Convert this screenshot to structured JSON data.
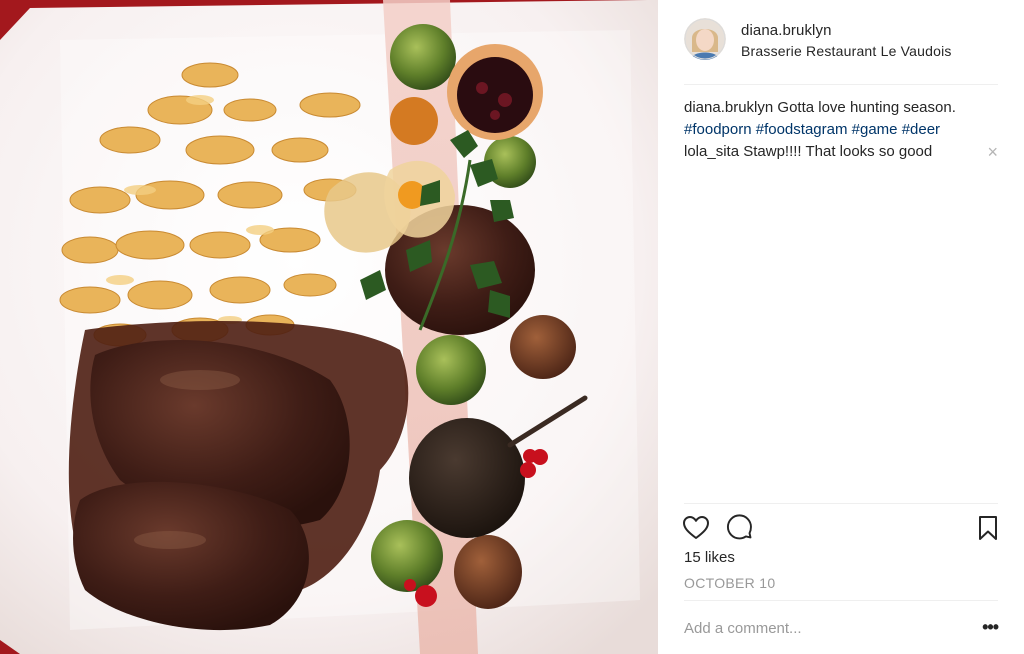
{
  "post": {
    "photo_description": "Plate of spaetzle noodles with venison steaks in dark gravy, Brussels sprouts, glazed chestnuts, a poached pear with lingonberries, physalis and parsley on a white plate",
    "user": {
      "username": "diana.bruklyn",
      "location": "Brasserie Restaurant Le Vaudois",
      "avatar_icon": "profile-avatar"
    },
    "caption": {
      "username": "diana.bruklyn",
      "text": "Gotta love hunting season.",
      "hashtags": [
        "#foodporn",
        "#foodstagram",
        "#game",
        "#deer"
      ]
    },
    "comments": [
      {
        "username": "lola_sita",
        "text": "Stawp!!!! That looks so good",
        "remove_icon": "×"
      }
    ],
    "actions": {
      "like_icon": "heart-icon",
      "comment_icon": "comment-bubble-icon",
      "save_icon": "bookmark-icon"
    },
    "likes_text": "15 likes",
    "date_text": "OCTOBER 10",
    "add_comment_placeholder": "Add a comment...",
    "more_options_label": "•••",
    "colors": {
      "text": "#262626",
      "hashtag": "#003569",
      "muted": "#999999",
      "divider": "#efefef"
    }
  }
}
